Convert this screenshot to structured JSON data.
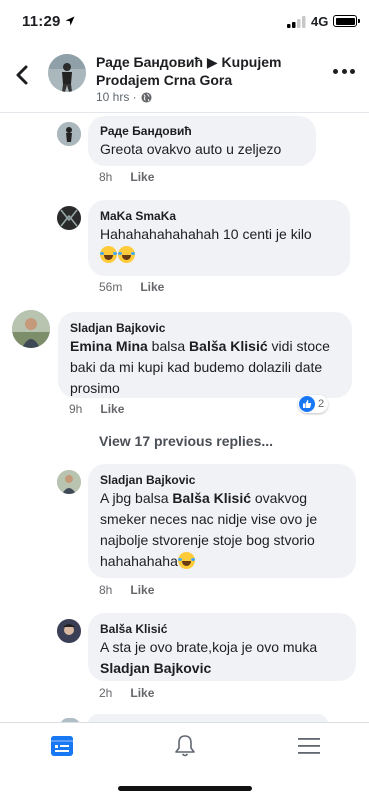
{
  "status_bar": {
    "time": "11:29",
    "network": "4G"
  },
  "header": {
    "title": "Раде Бандовић ▶ Kupujem Prodajem Crna Gora",
    "time": "10 hrs ·"
  },
  "comments": [
    {
      "author": "Раде Бандовић",
      "text": "Greota ovakvo auto u zeljezo",
      "time": "8h",
      "like": "Like"
    },
    {
      "author": "MaKa SmaKa",
      "text": "Hahahahahahahah 10 centi je kilo",
      "time": "56m",
      "like": "Like"
    },
    {
      "author": "Sladjan Bajkovic",
      "mention": "Emina Mina",
      "text_a": " balsa ",
      "mention2": "Balša Klisić",
      "text_b": " vidi stoce baki da mi kupi kad budemo dolazili date prosimo",
      "time": "9h",
      "like": "Like",
      "reaction_count": "2"
    },
    {
      "author": "Sladjan Bajkovic",
      "text_a": "A jbg balsa ",
      "mention": "Balša Klisić",
      "text_b": " ovakvog smeker neces nac nidje vise ovo je najbolje stvorenje stoje bog stvorio hahahahaha",
      "time": "8h",
      "like": "Like"
    },
    {
      "author": "Balša Klisić",
      "text": "A sta je ovo brate,koja je ovo muka ",
      "mention": "Sladjan Bajkovic",
      "time": "2h",
      "like": "Like"
    }
  ],
  "view_previous": "View 17 previous replies...",
  "bottom_tabs": [
    {
      "icon": "news-feed-icon",
      "color": "#1877f2"
    },
    {
      "icon": "bell-icon",
      "color": "#606770"
    },
    {
      "icon": "menu-icon",
      "color": "#606770"
    }
  ]
}
